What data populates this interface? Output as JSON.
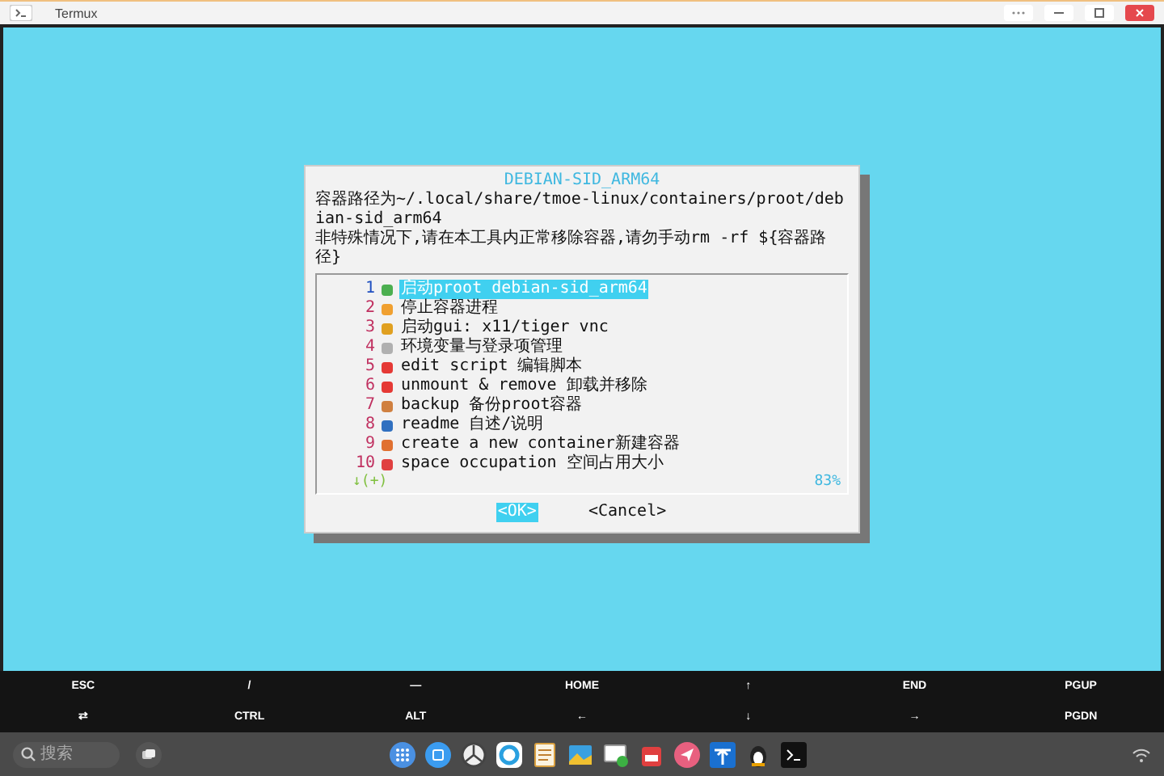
{
  "window": {
    "title": "Termux"
  },
  "dialog": {
    "title": "DEBIAN-SID_ARM64",
    "message": [
      "容器路径为~/.local/share/tmoe-linux/containers/proot/debian-sid_arm64",
      "非特殊情况下,请在本工具内正常移除容器,请勿手动rm -rf ${容器路径}"
    ],
    "items": [
      {
        "number": "1",
        "label": "启动proot debian-sid_arm64",
        "selected": true
      },
      {
        "number": "2",
        "label": "停止容器进程",
        "selected": false
      },
      {
        "number": "3",
        "label": "启动gui: x11/tiger vnc",
        "selected": false
      },
      {
        "number": "4",
        "label": "环境变量与登录项管理",
        "selected": false
      },
      {
        "number": "5",
        "label": "edit script 编辑脚本",
        "selected": false
      },
      {
        "number": "6",
        "label": "unmount & remove 卸载并移除",
        "selected": false
      },
      {
        "number": "7",
        "label": "backup 备份proot容器",
        "selected": false
      },
      {
        "number": "8",
        "label": "readme 自述/说明",
        "selected": false
      },
      {
        "number": "9",
        "label": "create a new container新建容器",
        "selected": false
      },
      {
        "number": "10",
        "label": "space occupation 空间占用大小",
        "selected": false
      }
    ],
    "more": "↓(+)",
    "percent": "83%",
    "buttons": [
      {
        "label": "<OK>",
        "selected": true
      },
      {
        "label": "<Cancel>",
        "selected": false
      }
    ]
  },
  "extra_keys": [
    "ESC",
    "/",
    "—",
    "HOME",
    "↑",
    "END",
    "PGUP",
    "⇄",
    "CTRL",
    "ALT",
    "←",
    "↓",
    "→",
    "PGDN"
  ],
  "taskbar": {
    "search": {
      "placeholder": "搜索"
    }
  }
}
